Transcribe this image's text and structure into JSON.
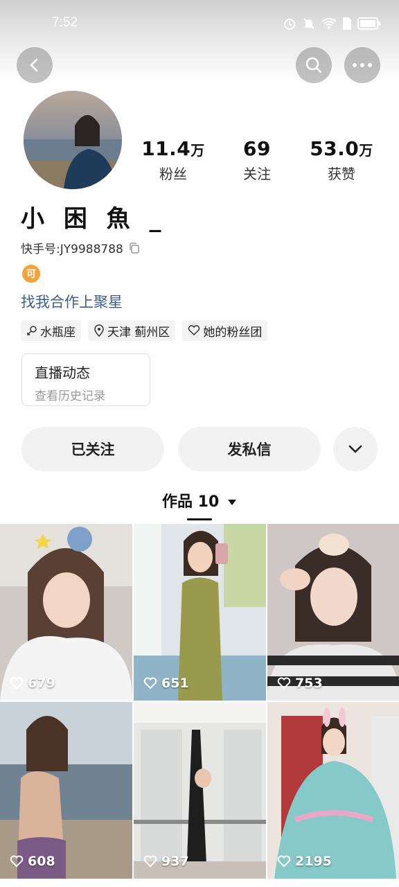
{
  "status_bar": {
    "time": "7:52"
  },
  "profile": {
    "nickname": "小 困 魚 _",
    "kuaishou_id_label": "快手号:",
    "kuaishou_id": "JY9988788",
    "badge": "可",
    "bio": "找我合作上聚星"
  },
  "stats": {
    "fans": {
      "value": "11.4",
      "unit": "万",
      "label": "粉丝"
    },
    "following": {
      "value": "69",
      "unit": "",
      "label": "关注"
    },
    "likes": {
      "value": "53.0",
      "unit": "万",
      "label": "获赞"
    }
  },
  "tags": [
    {
      "label": "水瓶座",
      "icon": "zodiac-icon"
    },
    {
      "label": "天津 蓟州区",
      "icon": "location-icon"
    },
    {
      "label": "她的粉丝团",
      "icon": "fan-club-icon"
    }
  ],
  "live_card": {
    "title": "直播动态",
    "subtitle": "查看历史记录"
  },
  "actions": {
    "followed": "已关注",
    "message": "发私信"
  },
  "works_tab": {
    "label": "作品 10"
  },
  "works": [
    {
      "likes": "679"
    },
    {
      "likes": "651"
    },
    {
      "likes": "753"
    },
    {
      "likes": "608"
    },
    {
      "likes": "937"
    },
    {
      "likes": "2195"
    }
  ],
  "colors": {
    "bio_link": "#3d5e8c",
    "badge": "#f6a23c",
    "button_bg": "#f2f2f2"
  }
}
